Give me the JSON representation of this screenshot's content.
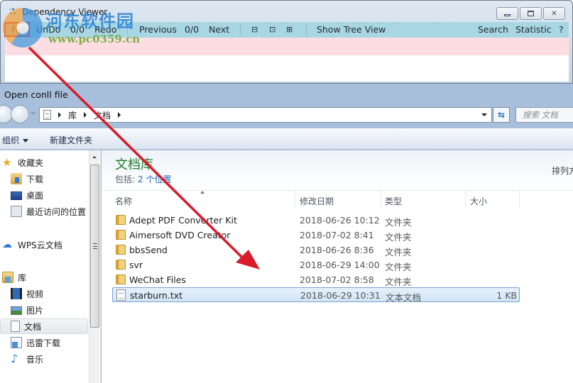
{
  "viewer": {
    "title": "Dependency Viewer",
    "window_controls": {
      "minimize": "—",
      "maximize": "□",
      "close": "✕"
    },
    "toolbar": {
      "file": "File",
      "undo": "UnDo",
      "undo_count": "0/0",
      "redo": "Redo",
      "previous": "Previous",
      "nav_count": "0/0",
      "next": "Next",
      "collapse_icon": "⊟",
      "fit_icon": "⊡",
      "expand_icon": "⊞",
      "show_tree_view": "Show Tree View",
      "search": "Search",
      "statistic": "Statistic",
      "help": "?"
    }
  },
  "watermark": {
    "text": "河东软件园",
    "url": "www.pc0359.cn"
  },
  "dialog": {
    "title": "Open conll file",
    "breadcrumb": [
      "库",
      "文档"
    ],
    "search_placeholder": "搜索 文档",
    "refresh_icon": "⇆",
    "commands": {
      "organize": "组织",
      "new_folder": "新建文件夹"
    },
    "sidebar": {
      "favorites": {
        "label": "收藏夹",
        "items": [
          {
            "label": "下载",
            "icon": "download-folder-icon"
          },
          {
            "label": "桌面",
            "icon": "desktop-icon"
          },
          {
            "label": "最近访问的位置",
            "icon": "recent-places-icon"
          }
        ]
      },
      "wps": {
        "label": "WPS云文档",
        "icon": "cloud-icon"
      },
      "libraries": {
        "label": "库",
        "items": [
          {
            "label": "视频",
            "icon": "video-icon"
          },
          {
            "label": "图片",
            "icon": "pictures-icon"
          },
          {
            "label": "文档",
            "icon": "documents-icon",
            "selected": true
          },
          {
            "label": "迅雷下载",
            "icon": "thunder-download-icon"
          },
          {
            "label": "音乐",
            "icon": "music-icon"
          }
        ]
      }
    },
    "library": {
      "title": "文档库",
      "includes_label": "包括:",
      "includes_link": "2 个位置",
      "arrange_by": "排列方"
    },
    "columns": [
      "名称",
      "修改日期",
      "类型",
      "大小"
    ],
    "files": [
      {
        "name": "Adept PDF Converter Kit",
        "date": "2018-06-26 10:12",
        "type": "文件夹",
        "size": "",
        "kind": "folder"
      },
      {
        "name": "Aimersoft DVD Creator",
        "date": "2018-07-02 8:41",
        "type": "文件夹",
        "size": "",
        "kind": "folder"
      },
      {
        "name": "bbsSend",
        "date": "2018-06-26 8:36",
        "type": "文件夹",
        "size": "",
        "kind": "folder"
      },
      {
        "name": "svr",
        "date": "2018-06-29 14:00",
        "type": "文件夹",
        "size": "",
        "kind": "folder"
      },
      {
        "name": "WeChat Files",
        "date": "2018-07-02 8:58",
        "type": "文件夹",
        "size": "",
        "kind": "folder"
      },
      {
        "name": "starburn.txt",
        "date": "2018-06-29 10:31",
        "type": "文本文档",
        "size": "1 KB",
        "kind": "text",
        "selected": true
      }
    ]
  },
  "colors": {
    "toolbar_bg": "#a9d6e3",
    "pink_bar": "#fddde1",
    "library_title": "#1e7d2e",
    "link": "#1c63b7",
    "annotation_red": "#d91b2a"
  }
}
